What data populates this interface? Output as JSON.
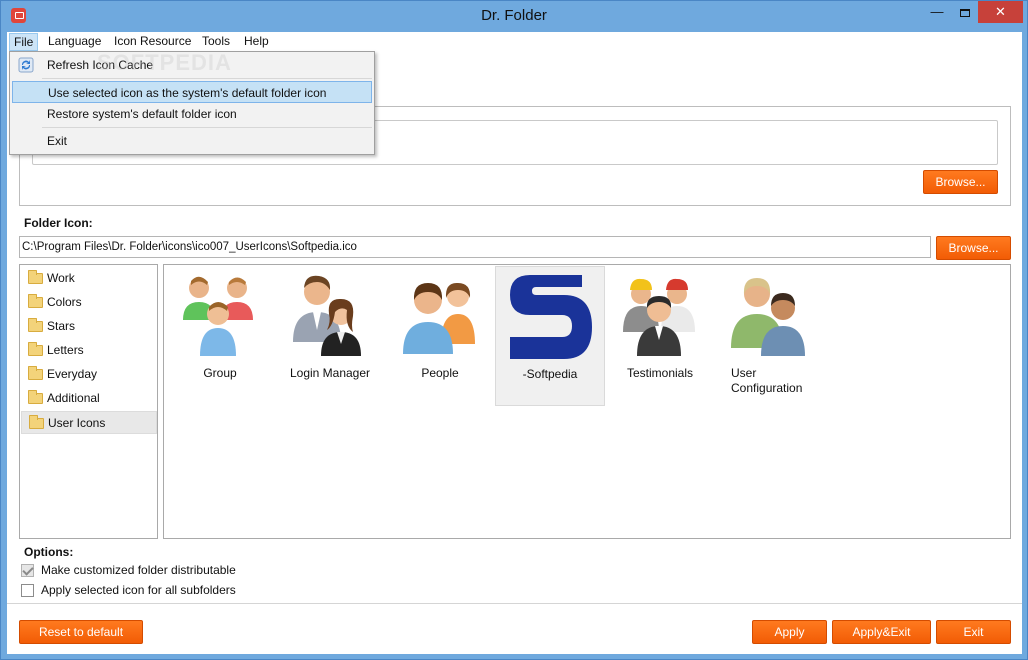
{
  "window": {
    "title": "Dr. Folder",
    "minimize_glyph": "—",
    "close_glyph": "✕"
  },
  "menubar": {
    "items": [
      "File",
      "Language",
      "Icon Resource",
      "Tools",
      "Help"
    ]
  },
  "file_menu": {
    "items": [
      "Refresh Icon Cache",
      "Use selected icon as the system's default folder icon",
      "Restore system's default folder icon",
      "Exit"
    ],
    "highlighted_index": 1
  },
  "watermark": "SOFTPEDIA",
  "top_group": {
    "browse_label": "Browse..."
  },
  "folder_icon": {
    "label": "Folder Icon:",
    "path": "C:\\Program Files\\Dr. Folder\\icons\\ico007_UserIcons\\Softpedia.ico",
    "browse_label": "Browse..."
  },
  "categories": {
    "items": [
      "Work",
      "Colors",
      "Stars",
      "Letters",
      "Everyday",
      "Additional",
      "User Icons"
    ],
    "selected_index": 6
  },
  "icons": {
    "items": [
      {
        "label": "Group"
      },
      {
        "label": "Login Manager"
      },
      {
        "label": "People"
      },
      {
        "label": "-Softpedia"
      },
      {
        "label": "Testimonials"
      },
      {
        "label": "User\nConfiguration"
      }
    ],
    "selected_index": 3
  },
  "options": {
    "label": "Options:",
    "items": [
      {
        "label": "Make customized folder distributable",
        "checked": true
      },
      {
        "label": "Apply selected icon for all subfolders",
        "checked": false
      }
    ]
  },
  "footer": {
    "reset_label": "Reset to default",
    "apply_label": "Apply",
    "apply_exit_label": "Apply&Exit",
    "exit_label": "Exit"
  },
  "colors": {
    "accent": "#f25c05",
    "titlebar": "#6fa9de",
    "close": "#c7413a",
    "highlight": "#c5e1f5"
  }
}
